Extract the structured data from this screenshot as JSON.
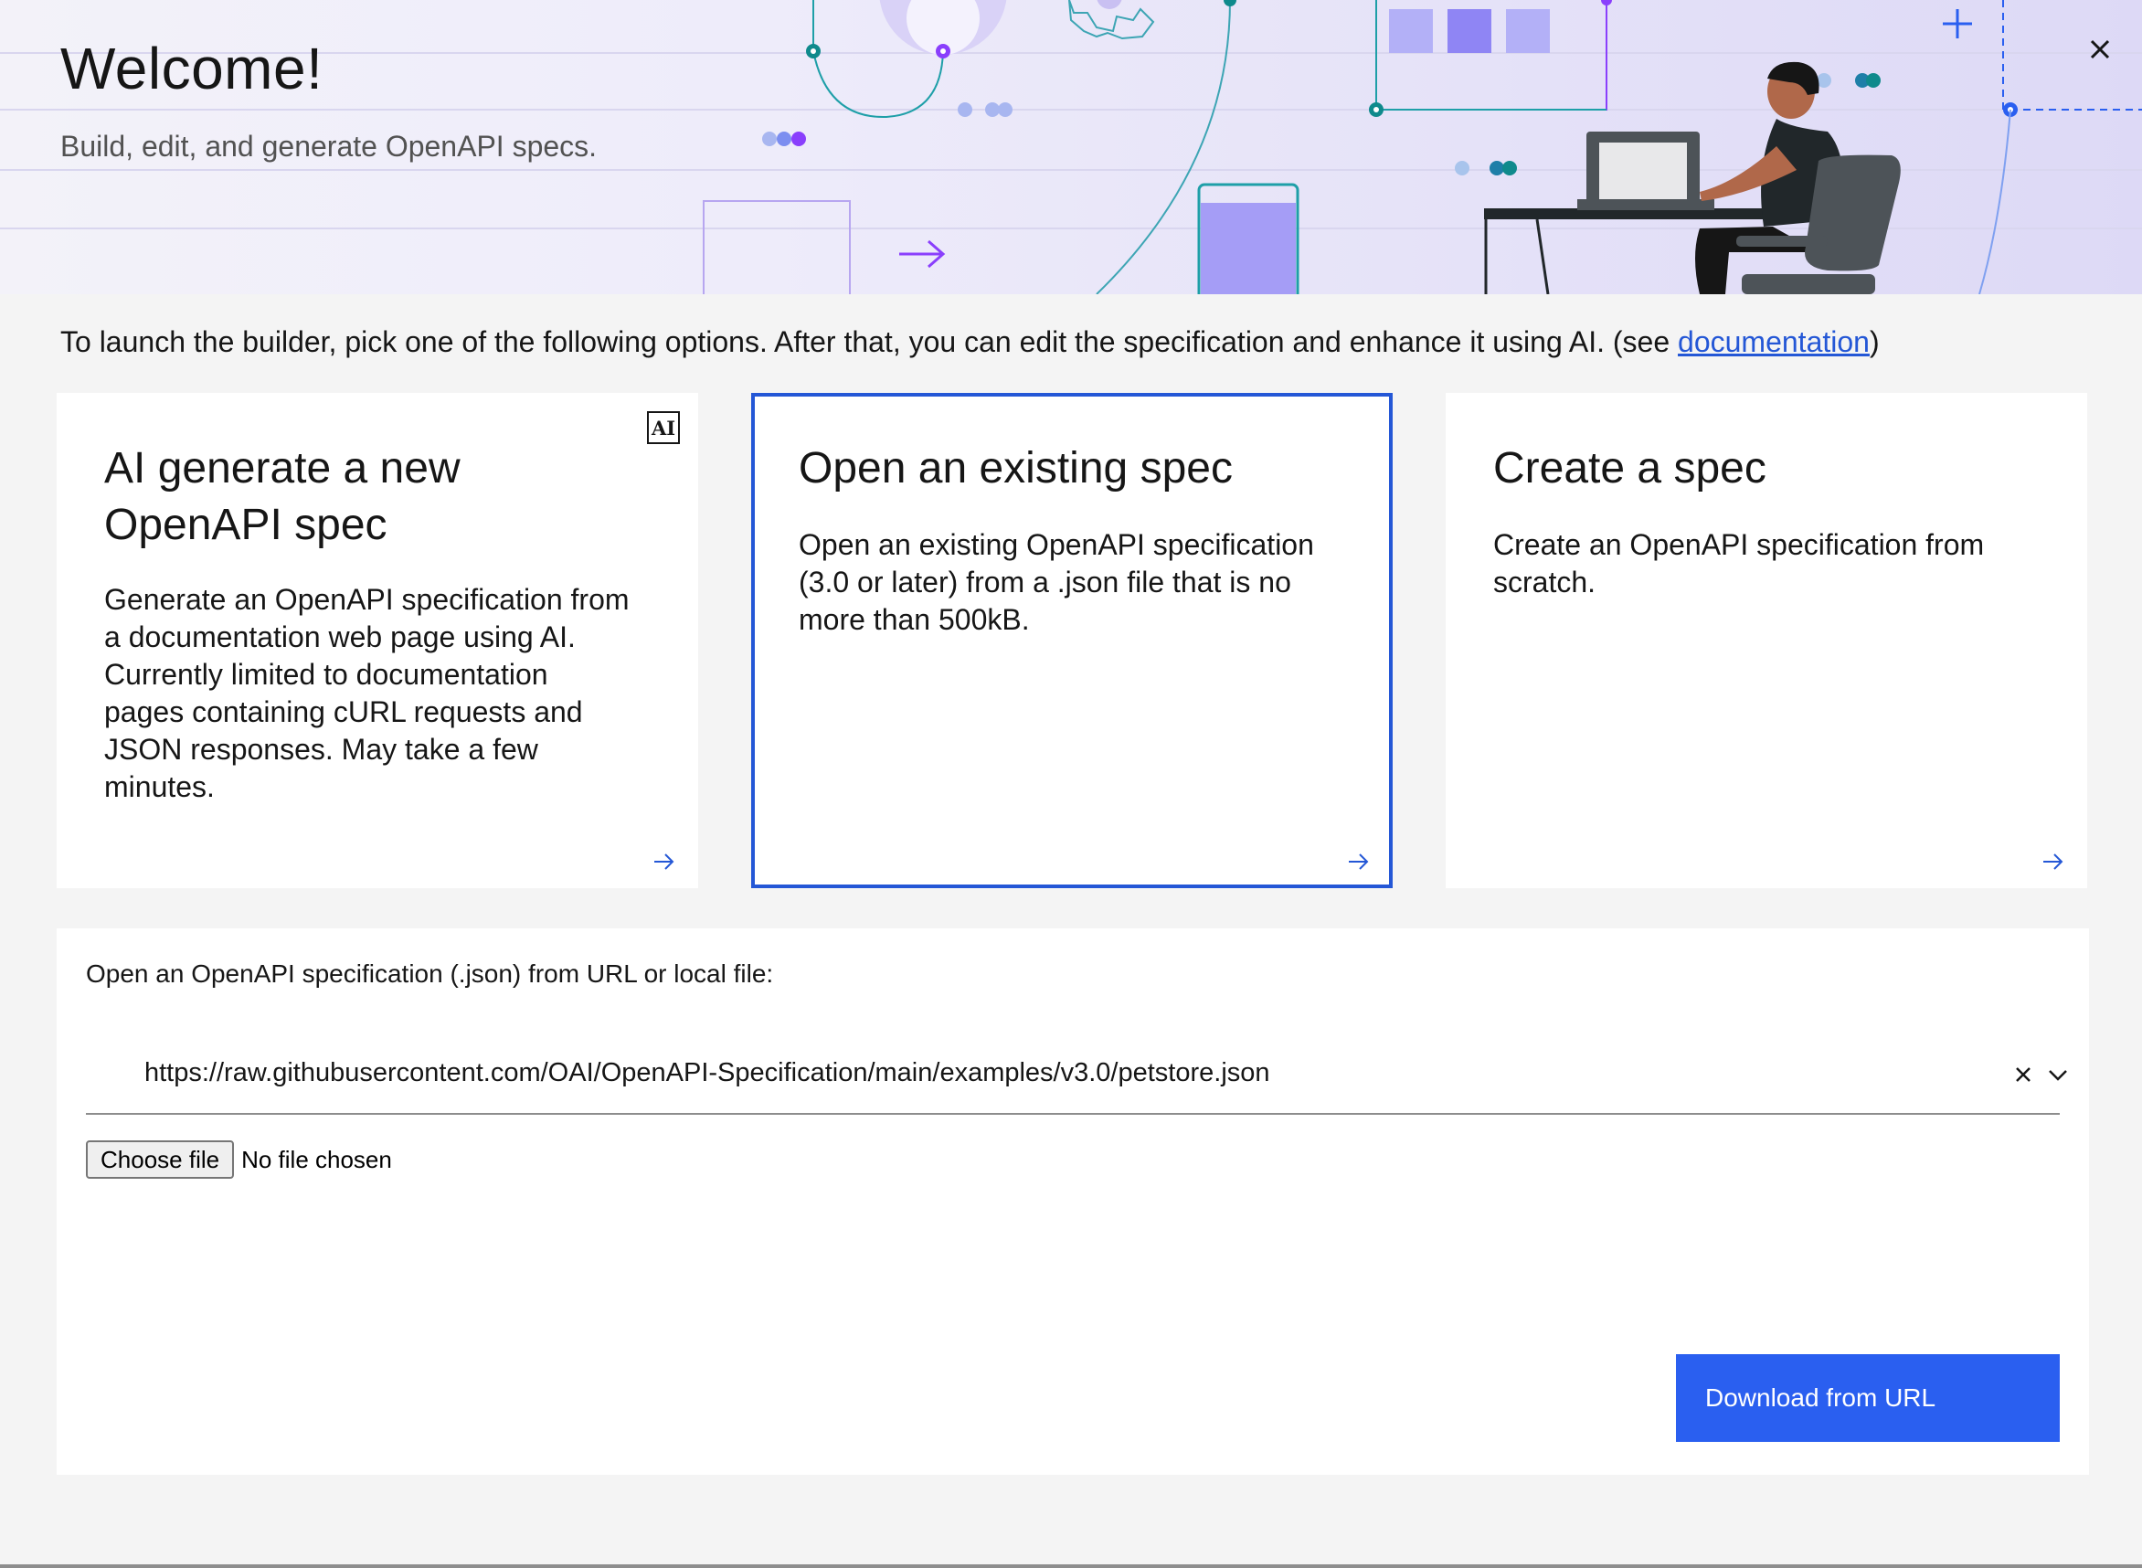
{
  "header": {
    "title": "Welcome!",
    "subtitle": "Build, edit, and generate OpenAPI specs.",
    "close_icon": "close-icon"
  },
  "intro": {
    "text": "To launch the builder, pick one of the following options. After that, you can edit the specification and enhance it using AI. (see ",
    "link_label": "documentation",
    "suffix": ")"
  },
  "cards": [
    {
      "title": "AI generate a new OpenAPI spec",
      "description": "Generate an OpenAPI specification from a documentation web page using AI. Currently limited to documentation pages containing cURL requests and JSON responses. May take a few minutes.",
      "badge": "AI",
      "selected": false
    },
    {
      "title": "Open an existing spec",
      "description": "Open an existing OpenAPI specification (3.0 or later) from a .json file that is no more than 500kB.",
      "selected": true
    },
    {
      "title": "Create a spec",
      "description": "Create an OpenAPI specification from scratch.",
      "selected": false
    }
  ],
  "open_panel": {
    "label": "Open an OpenAPI specification (.json) from URL or local file:",
    "url_value": "https://raw.githubusercontent.com/OAI/OpenAPI-Specification/main/examples/v3.0/petstore.json",
    "file_button": "Choose file",
    "file_status": "No file chosen",
    "download_button": "Download from URL"
  },
  "colors": {
    "accent": "#2457d6",
    "button": "#2a5ff0",
    "page_bg": "#f4f4f4",
    "card_bg": "#ffffff"
  }
}
